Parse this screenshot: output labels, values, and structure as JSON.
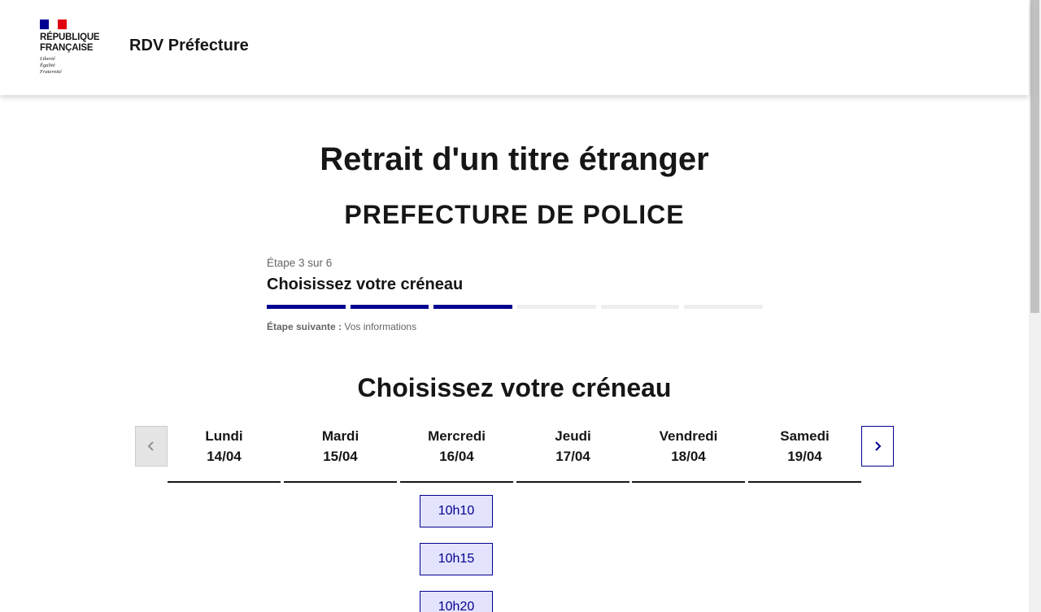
{
  "header": {
    "republic_line1": "RÉPUBLIQUE",
    "republic_line2": "FRANÇAISE",
    "motto": [
      "Liberté",
      "Égalité",
      "Fraternité"
    ],
    "service_title": "RDV Préfecture"
  },
  "page": {
    "title": "Retrait d'un titre étranger",
    "subtitle": "PREFECTURE DE POLICE"
  },
  "stepper": {
    "state": "Étape 3 sur 6",
    "title": "Choisissez votre créneau",
    "current_step": 3,
    "total_steps": 6,
    "next_label": "Étape suivante :",
    "next_value": "Vos informations"
  },
  "calendar": {
    "section_title": "Choisissez votre créneau",
    "prev_label": "Semaine précédente",
    "next_label": "Semaine suivante",
    "days": [
      {
        "name": "Lundi",
        "date": "14/04"
      },
      {
        "name": "Mardi",
        "date": "15/04"
      },
      {
        "name": "Mercredi",
        "date": "16/04"
      },
      {
        "name": "Jeudi",
        "date": "17/04"
      },
      {
        "name": "Vendredi",
        "date": "18/04"
      },
      {
        "name": "Samedi",
        "date": "19/04"
      }
    ],
    "slots": [
      "10h10",
      "10h15",
      "10h20"
    ]
  },
  "colors": {
    "primary": "#000091",
    "slot_bg": "#e3e3fd",
    "flag_red": "#e1000f"
  }
}
